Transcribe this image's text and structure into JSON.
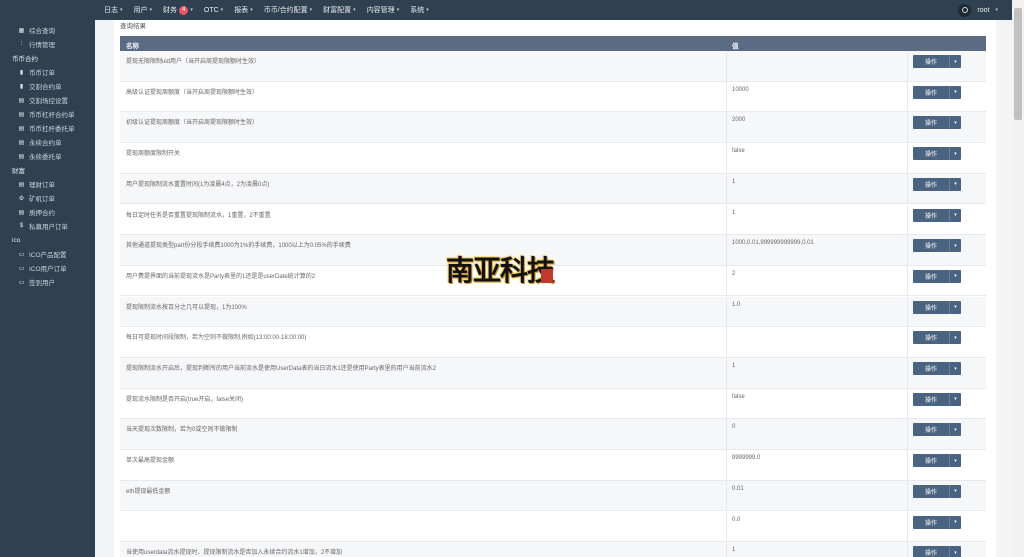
{
  "topnav": {
    "items": [
      {
        "label": "日志",
        "caret": true
      },
      {
        "label": "用户",
        "caret": true
      },
      {
        "label": "财务",
        "badge": "4",
        "caret": true
      },
      {
        "label": "OTC",
        "caret": true
      },
      {
        "label": "报表",
        "caret": true
      },
      {
        "label": "币币/合约配置",
        "caret": true
      },
      {
        "label": "财富配置",
        "caret": true
      },
      {
        "label": "内容管理",
        "caret": true
      },
      {
        "label": "系统",
        "caret": true
      }
    ],
    "user": "root",
    "user_caret": "▾",
    "caret_glyph": "▾"
  },
  "sidebar": {
    "rows": [
      {
        "type": "item",
        "label": "综合查询",
        "icon": "grid-icon"
      },
      {
        "type": "item",
        "label": "行情管理",
        "icon": "chart-icon"
      },
      {
        "type": "group",
        "label": "币币合约"
      },
      {
        "type": "item",
        "label": "币币订单",
        "icon": "bookmark-icon"
      },
      {
        "type": "item",
        "label": "交割合约单",
        "icon": "bookmark-icon"
      },
      {
        "type": "item",
        "label": "交割场控设置",
        "icon": "document-icon"
      },
      {
        "type": "item",
        "label": "币币杠杆合约单",
        "icon": "document-icon"
      },
      {
        "type": "item",
        "label": "币币杠杆委托单",
        "icon": "document-icon"
      },
      {
        "type": "item",
        "label": "永续合约单",
        "icon": "document-icon"
      },
      {
        "type": "item",
        "label": "永续委托单",
        "icon": "document-icon"
      },
      {
        "type": "group",
        "label": "财富"
      },
      {
        "type": "item",
        "label": "理财订单",
        "icon": "document-icon"
      },
      {
        "type": "item",
        "label": "矿机订单",
        "icon": "gear-icon"
      },
      {
        "type": "item",
        "label": "质押合约",
        "icon": "document-icon"
      },
      {
        "type": "item",
        "label": "私募用户订单",
        "icon": "dollar-icon"
      },
      {
        "type": "group",
        "label": "ico"
      },
      {
        "type": "item",
        "label": "ICO产品配置",
        "icon": "monitor-icon"
      },
      {
        "type": "item",
        "label": "ICO用户订单",
        "icon": "monitor-icon"
      },
      {
        "type": "item",
        "label": "签到用户",
        "icon": "monitor-icon"
      }
    ]
  },
  "panel": {
    "title": "查询结果",
    "col_name": "名称",
    "col_value": "值",
    "op_label": "操作",
    "op_caret": "▾"
  },
  "rows": [
    {
      "name": "提现无限限制uid用户（当开启周提现限额时生效）",
      "value": ""
    },
    {
      "name": "高级认证提现周额度（当开启周提现限额时生效）",
      "value": "10000"
    },
    {
      "name": "初级认证提现周额度（当开启周提现限额时生效）",
      "value": "2000"
    },
    {
      "name": "提现周额度限制开关",
      "value": "false"
    },
    {
      "name": "用户提现限制流水重置时间(1为凌晨4点，2为凌晨0点)",
      "value": "1"
    },
    {
      "name": "每日定时任务是否重置提现限制流水，1重置，2不重置",
      "value": "1"
    },
    {
      "name": "其他通道提现类型part份分段手续费1000为1%的手续费，1000以上为0.05%的手续费",
      "value": "1000,0.01,999999999999,0.01"
    },
    {
      "name": "用户费提界面的当前提现流水是Party表里的1还是是userDate统计算的2",
      "value": "2"
    },
    {
      "name": "提现限制流水按百分之几可以提现，1为100%",
      "value": "1.0"
    },
    {
      "name": "每日可提现时间段限制，若为空则不做限制,例如(13:00:00-18:00:00)",
      "value": ""
    },
    {
      "name": "提现限制流水开启后，提现判断所的用户当前流水是使用UserData表的当日流水1还是使用Party表里的用户当前流水2",
      "value": "1"
    },
    {
      "name": "提现流水限制是否开启(true开启，false关闭)",
      "value": "false"
    },
    {
      "name": "当天提现次数限制，若为0或空则不做限制",
      "value": "0"
    },
    {
      "name": "单次最高提现金额",
      "value": "9999999.0"
    },
    {
      "name": "eth提现最低金额",
      "value": "0.01"
    },
    {
      "name": "",
      "value": "0.0"
    },
    {
      "name": "当使用userdata流水提现时，提现限制流水是否加入永续合约流水1增加，2不增加",
      "value": "1"
    }
  ],
  "colors": {
    "navbar": "#2f4050",
    "table_header": "#5b6b83",
    "op_button": "#4a6380",
    "badge": "#ed5565"
  }
}
